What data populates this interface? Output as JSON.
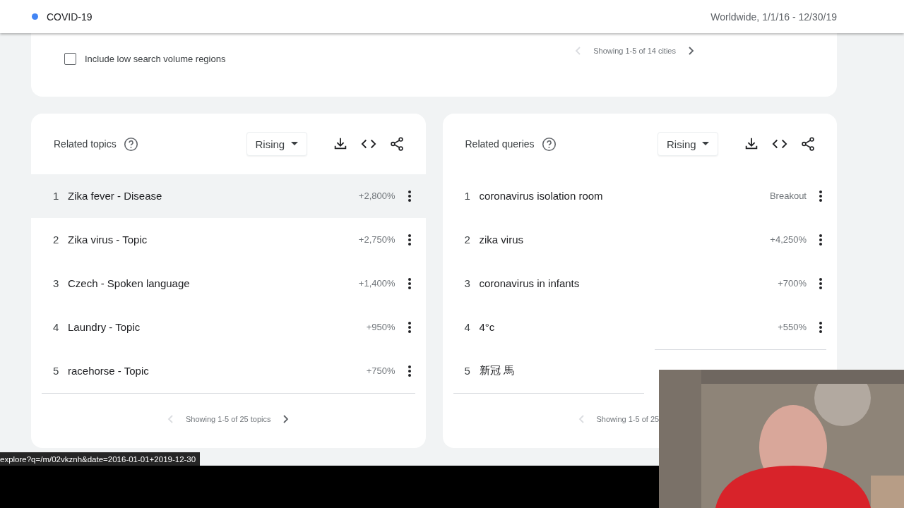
{
  "topbar": {
    "term": "COVID-19",
    "scope": "Worldwide, 1/1/16 - 12/30/19"
  },
  "regions_card": {
    "checkbox": {
      "label": "Include low search volume regions",
      "checked": false
    },
    "pager": {
      "text": "Showing 1-5 of 14 cities",
      "has_next": true
    }
  },
  "panels": [
    {
      "title": "Related topics",
      "filter": "Rising",
      "rows": [
        {
          "rank": "1",
          "label": "Zika fever - Disease",
          "value": "+2,800%",
          "highlighted": true
        },
        {
          "rank": "2",
          "label": "Zika virus - Topic",
          "value": "+2,750%",
          "highlighted": false
        },
        {
          "rank": "3",
          "label": "Czech - Spoken language",
          "value": "+1,400%",
          "highlighted": false
        },
        {
          "rank": "4",
          "label": "Laundry - Topic",
          "value": "+950%",
          "highlighted": false
        },
        {
          "rank": "5",
          "label": "racehorse - Topic",
          "value": "+750%",
          "highlighted": false
        }
      ],
      "pager": {
        "text": "Showing 1-5 of 25 topics",
        "has_next": true
      }
    },
    {
      "title": "Related queries",
      "filter": "Rising",
      "rows": [
        {
          "rank": "1",
          "label": "coronavirus isolation room",
          "value": "Breakout",
          "highlighted": false
        },
        {
          "rank": "2",
          "label": "zika virus",
          "value": "+4,250%",
          "highlighted": false
        },
        {
          "rank": "3",
          "label": "coronavirus in infants",
          "value": "+700%",
          "highlighted": false
        },
        {
          "rank": "4",
          "label": "4°c",
          "value": "+550%",
          "highlighted": false
        },
        {
          "rank": "5",
          "label": "新冠 馬",
          "highlighted": false
        }
      ],
      "pager": {
        "text": "Showing 1-5 of 25",
        "has_next": false
      }
    }
  ],
  "status_url": "explore?q=/m/02vkznh&date=2016-01-01+2019-12-30"
}
